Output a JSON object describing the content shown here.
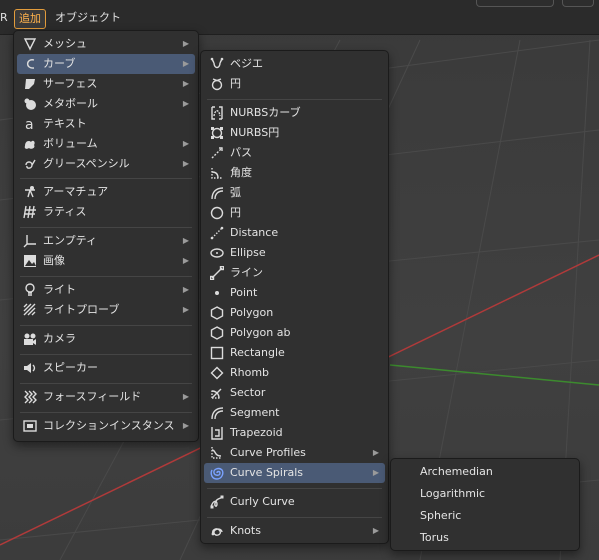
{
  "colors": {
    "accent": "#e29c3c",
    "highlight": "#4a5a75",
    "menu_bg": "#303030",
    "x_axis": "#b03a3a",
    "y_axis": "#3c8a2e"
  },
  "header": {
    "left_fragment": "R",
    "active_menu": "追加",
    "object_menu": "オブジェクト"
  },
  "add_menu": {
    "items": [
      {
        "label": "メッシュ",
        "icon": "mesh-icon"
      },
      {
        "label": "カーブ",
        "icon": "curve-icon"
      },
      {
        "label": "サーフェス",
        "icon": "surface-icon"
      },
      {
        "label": "メタボール",
        "icon": "metaball-icon"
      },
      {
        "label": "テキスト",
        "icon": "text-icon"
      },
      {
        "label": "ボリューム",
        "icon": "volume-icon"
      },
      {
        "label": "グリースペンシル",
        "icon": "grease-pencil-icon"
      },
      {
        "label": "アーマチュア",
        "icon": "armature-icon"
      },
      {
        "label": "ラティス",
        "icon": "lattice-icon"
      },
      {
        "label": "エンプティ",
        "icon": "empty-icon"
      },
      {
        "label": "画像",
        "icon": "image-icon"
      },
      {
        "label": "ライト",
        "icon": "light-icon"
      },
      {
        "label": "ライトプローブ",
        "icon": "light-probe-icon"
      },
      {
        "label": "カメラ",
        "icon": "camera-icon"
      },
      {
        "label": "スピーカー",
        "icon": "speaker-icon"
      },
      {
        "label": "フォースフィールド",
        "icon": "force-field-icon"
      },
      {
        "label": "コレクションインスタンス",
        "icon": "collection-instance-icon"
      }
    ]
  },
  "curve_menu": {
    "items": [
      {
        "label": "ベジエ",
        "icon": "bezier-icon"
      },
      {
        "label": "円",
        "icon": "bezier-circle-icon"
      },
      {
        "label": "NURBSカーブ",
        "icon": "nurbs-curve-icon"
      },
      {
        "label": "NURBS円",
        "icon": "nurbs-circle-icon"
      },
      {
        "label": "パス",
        "icon": "path-icon"
      },
      {
        "label": "角度",
        "icon": "angle-icon"
      },
      {
        "label": "弧",
        "icon": "arc-icon"
      },
      {
        "label": "円",
        "icon": "circle-icon"
      },
      {
        "label": "Distance",
        "icon": "distance-icon"
      },
      {
        "label": "Ellipse",
        "icon": "ellipse-icon"
      },
      {
        "label": "ライン",
        "icon": "line-icon"
      },
      {
        "label": "Point",
        "icon": "point-icon"
      },
      {
        "label": "Polygon",
        "icon": "polygon-icon"
      },
      {
        "label": "Polygon ab",
        "icon": "polygon-ab-icon"
      },
      {
        "label": "Rectangle",
        "icon": "rectangle-icon"
      },
      {
        "label": "Rhomb",
        "icon": "rhomb-icon"
      },
      {
        "label": "Sector",
        "icon": "sector-icon"
      },
      {
        "label": "Segment",
        "icon": "segment-icon"
      },
      {
        "label": "Trapezoid",
        "icon": "trapezoid-icon"
      },
      {
        "label": "Curve Profiles",
        "icon": "curve-profiles-icon"
      },
      {
        "label": "Curve Spirals",
        "icon": "spiral-icon"
      },
      {
        "label": "Curly Curve",
        "icon": "curly-curve-icon"
      },
      {
        "label": "Knots",
        "icon": "knots-icon"
      }
    ]
  },
  "spiral_menu": {
    "items": [
      {
        "label": "Archemedian"
      },
      {
        "label": "Logarithmic"
      },
      {
        "label": "Spheric"
      },
      {
        "label": "Torus"
      }
    ]
  }
}
